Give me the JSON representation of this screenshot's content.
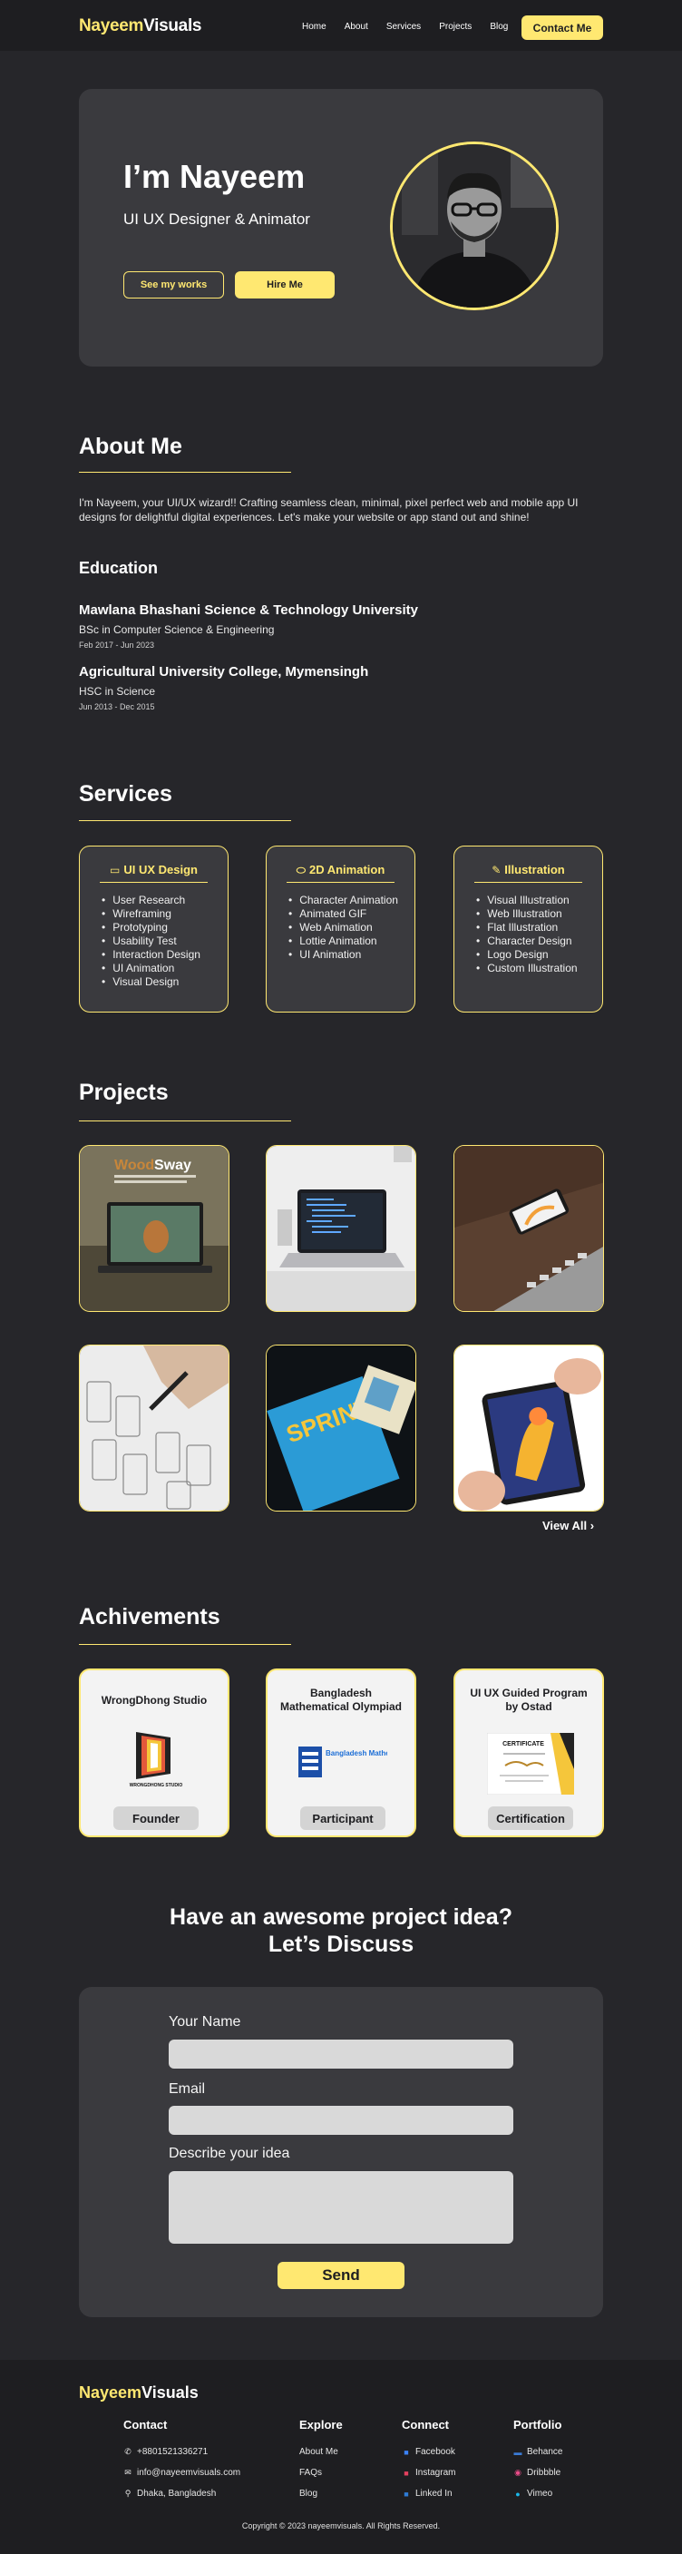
{
  "nav": {
    "logo_part1": "Nayeem",
    "logo_part2": "Visuals",
    "links": [
      "Home",
      "About",
      "Services",
      "Projects",
      "Blog"
    ],
    "contact_label": "Contact Me"
  },
  "hero": {
    "title": "I’m Nayeem",
    "subtitle": "UI UX Designer & Animator",
    "works_label": "See my works",
    "hire_label": "Hire Me"
  },
  "about": {
    "heading": "About Me",
    "text": "I'm Nayeem, your UI/UX wizard!! Crafting seamless clean, minimal, pixel perfect web and mobile app UI designs for delightful digital experiences. Let's make your website or app stand out and shine!",
    "education_heading": "Education",
    "education": [
      {
        "school": "Mawlana Bhashani Science & Technology University",
        "degree": "BSc in Computer Science & Engineering",
        "dates": "Feb 2017 - Jun 2023"
      },
      {
        "school": "Agricultural University College, Mymensingh",
        "degree": "HSC in Science",
        "dates": "Jun 2013 - Dec 2015"
      }
    ]
  },
  "services": {
    "heading": "Services",
    "cards": [
      {
        "title": "UI UX Design",
        "icon": "monitor-icon",
        "items": [
          "User Research",
          "Wireframing",
          "Prototyping",
          "Usability Test",
          "Interaction Design",
          "UI Animation",
          "Visual Design"
        ]
      },
      {
        "title": "2D Animation",
        "icon": "pill-icon",
        "items": [
          "Character Animation",
          "Animated GIF",
          "Web Animation",
          "Lottie Animation",
          "UI Animation"
        ]
      },
      {
        "title": "Illustration",
        "icon": "brush-icon",
        "items": [
          "Visual Illustration",
          "Web Illustration",
          "Flat Illustration",
          "Character Design",
          "Logo Design",
          "Custom Illustration"
        ]
      }
    ]
  },
  "projects": {
    "heading": "Projects",
    "thumb1_brand_a": "Wood",
    "thumb1_brand_b": "Sway",
    "thumb5_text": "SPRINT",
    "view_all": "View All"
  },
  "achievements": {
    "heading": "Achivements",
    "cards": [
      {
        "title": "WrongDhong Studio",
        "logo_text": "WRONGDHONG STUDIO",
        "badge": "Founder"
      },
      {
        "title": "Bangladesh Mathematical Olympiad",
        "logo_text": "Bangladesh Mathematical Olympiad",
        "badge": "Participant"
      },
      {
        "title": "UI UX Guided Program by Ostad",
        "logo_text": "CERTIFICATE",
        "badge": "Certification"
      }
    ]
  },
  "contact": {
    "cta_line1": "Have an awesome project idea?",
    "cta_line2": "Let’s Discuss",
    "name_label": "Your Name",
    "email_label": "Email",
    "idea_label": "Describe your idea",
    "send_label": "Send"
  },
  "footer": {
    "contact_heading": "Contact",
    "phone": "+8801521336271",
    "email": "info@nayeemvisuals.com",
    "location": "Dhaka, Bangladesh",
    "explore_heading": "Explore",
    "explore": [
      "About Me",
      "FAQs",
      "Blog"
    ],
    "connect_heading": "Connect",
    "connect": [
      "Facebook",
      "Instagram",
      "Linked In"
    ],
    "portfolio_heading": "Portfolio",
    "portfolio": [
      "Behance",
      "Dribbble",
      "Vimeo"
    ],
    "copyright": "Copyright © 2023 nayeemvisuals. All Rights Reserved."
  },
  "colors": {
    "accent": "#ffe871",
    "background": "#26262a",
    "card": "#3a3a3e",
    "nav": "#1e1e21"
  }
}
